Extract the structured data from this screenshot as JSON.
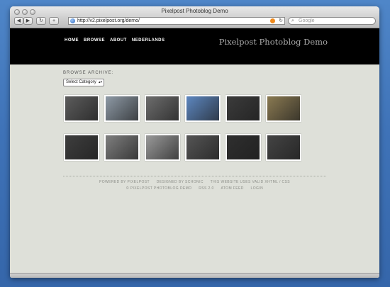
{
  "window": {
    "title": "Pixelpost Photoblog Demo"
  },
  "toolbar": {
    "back": "◀",
    "forward": "▶",
    "reload": "↻",
    "add": "+"
  },
  "address_bar": {
    "url": "http://v2.pixelpost.org/demo/"
  },
  "search": {
    "placeholder": "Google"
  },
  "site": {
    "title": "Pixelpost Photoblog Demo",
    "nav": [
      "HOME",
      "BROWSE",
      "ABOUT",
      "NEDERLANDS"
    ]
  },
  "archive": {
    "label": "BROWSE ARCHIVE:",
    "select_value": "Select Category"
  },
  "thumbnails": [
    {
      "name": "thumb-1",
      "color": "#5c5c5c"
    },
    {
      "name": "thumb-2",
      "color": "#8e9aa6"
    },
    {
      "name": "thumb-3",
      "color": "#6d6d6d"
    },
    {
      "name": "thumb-4",
      "color": "#5d87c0"
    },
    {
      "name": "thumb-5",
      "color": "#3b3b3b"
    },
    {
      "name": "thumb-6",
      "color": "#8a7a52"
    },
    {
      "name": "thumb-7",
      "color": "#3e3e3e"
    },
    {
      "name": "thumb-8",
      "color": "#7f7f7f"
    },
    {
      "name": "thumb-9",
      "color": "#9a9a9a"
    },
    {
      "name": "thumb-10",
      "color": "#555555"
    },
    {
      "name": "thumb-11",
      "color": "#2f2f2f"
    },
    {
      "name": "thumb-12",
      "color": "#444444"
    }
  ],
  "footer": {
    "line1": [
      "POWERED BY PIXELPOST",
      "DESIGNED BY SCHONIC",
      "THIS WEBSITE USES VALID XHTML / CSS"
    ],
    "line2": [
      "© PIXELPOST PHOTOBLOG DEMO",
      "RSS 2.0",
      "ATOM FEED",
      "LOGIN"
    ]
  }
}
